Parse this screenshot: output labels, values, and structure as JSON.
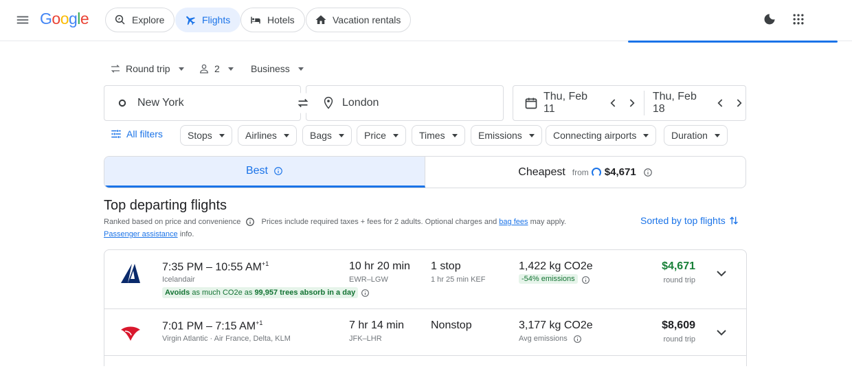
{
  "header": {
    "logo": [
      "G",
      "o",
      "o",
      "g",
      "l",
      "e"
    ],
    "logo_colors": [
      "#4285F4",
      "#EA4335",
      "#FBBC05",
      "#4285F4",
      "#34A853",
      "#EA4335"
    ],
    "nav": [
      {
        "label": "Explore",
        "icon": "explore-icon"
      },
      {
        "label": "Flights",
        "icon": "plane-icon",
        "active": true
      },
      {
        "label": "Hotels",
        "icon": "bed-icon"
      },
      {
        "label": "Vacation rentals",
        "icon": "house-icon"
      }
    ]
  },
  "search": {
    "trip_type": "Round trip",
    "passengers": "2",
    "cabin": "Business",
    "origin": "New York",
    "destination": "London",
    "depart_date": "Thu, Feb 11",
    "return_date": "Thu, Feb 18"
  },
  "filters": {
    "all_filters": "All filters",
    "chips": [
      "Stops",
      "Airlines",
      "Bags",
      "Price",
      "Times",
      "Emissions",
      "Connecting airports",
      "Duration"
    ]
  },
  "tabs": {
    "best": "Best",
    "cheapest": "Cheapest",
    "from": "from",
    "cheapest_price": "$4,671"
  },
  "results_header": {
    "title": "Top departing flights",
    "ranked": "Ranked based on price and convenience",
    "prices_note": "Prices include required taxes + fees for 2 adults. Optional charges and",
    "bag_fees": "bag fees",
    "may_apply": "may apply.",
    "passenger_assistance": "Passenger assistance",
    "info": "info.",
    "sorted": "Sorted by top flights"
  },
  "flights": [
    {
      "times": "7:35 PM – 10:55 AM",
      "plus_day": "+1",
      "airline": "Icelandair",
      "duration": "10 hr 20 min",
      "route": "EWR–LGW",
      "stops": "1 stop",
      "stop_detail": "1 hr 25 min KEF",
      "co2": "1,422 kg CO2e",
      "emissions_badge": "-54% emissions",
      "avoid_prefix": "Avoids",
      "avoid_mid": "as much CO2e as",
      "avoid_trees": "99,957 trees absorb in a day",
      "price": "$4,671",
      "price_color": "#188038",
      "price_type": "round trip"
    },
    {
      "times": "7:01 PM – 7:15 AM",
      "plus_day": "+1",
      "airline": "Virgin Atlantic · Air France, Delta, KLM",
      "duration": "7 hr 14 min",
      "route": "JFK–LHR",
      "stops": "Nonstop",
      "co2": "3,177 kg CO2e",
      "emissions_note": "Avg emissions",
      "price": "$8,609",
      "price_color": "#202124",
      "price_type": "round trip"
    }
  ],
  "colors": {
    "accent": "#1a73e8",
    "green": "#188038"
  }
}
